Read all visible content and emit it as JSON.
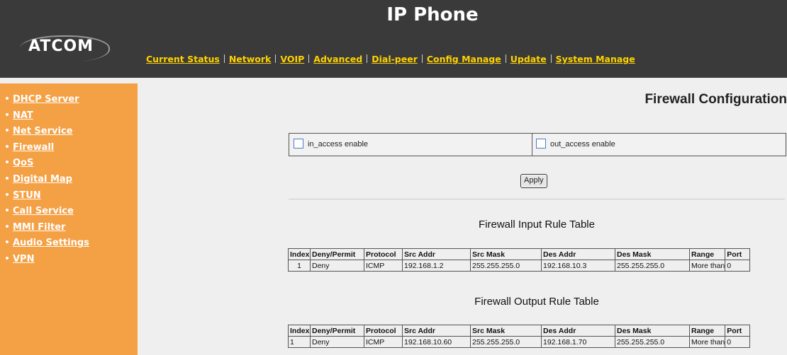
{
  "header": {
    "logo_text": "ATCOM",
    "title": "IP Phone",
    "nav": [
      "Current Status",
      "Network",
      "VOIP",
      "Advanced",
      "Dial-peer",
      "Config Manage",
      "Update",
      "System Manage"
    ]
  },
  "sidebar": {
    "items": [
      "DHCP Server",
      "NAT",
      "Net Service",
      "Firewall",
      "QoS",
      "Digital Map",
      "STUN",
      "Call Service",
      "MMI Filter",
      "Audio Settings",
      "VPN"
    ]
  },
  "main": {
    "page_title": "Firewall Configuration",
    "in_access_label": "in_access enable",
    "in_access_checked": false,
    "out_access_label": "out_access enable",
    "out_access_checked": false,
    "apply_label": "Apply",
    "input_table": {
      "title": "Firewall Input Rule Table",
      "headers": [
        "Index",
        "Deny/Permit",
        "Protocol",
        "Src Addr",
        "Src Mask",
        "Des Addr",
        "Des Mask",
        "Range",
        "Port"
      ],
      "rows": [
        [
          "1",
          "Deny",
          "ICMP",
          "192.168.1.2",
          "255.255.255.0",
          "192.168.10.3",
          "255.255.255.0",
          "More than",
          "0"
        ]
      ]
    },
    "output_table": {
      "title": "Firewall Output Rule Table",
      "headers": [
        "Index",
        "Deny/Permit",
        "Protocol",
        "Src Addr",
        "Src Mask",
        "Des Addr",
        "Des Mask",
        "Range",
        "Port"
      ],
      "rows": [
        [
          "1",
          "Deny",
          "ICMP",
          "192.168.10.60",
          "255.255.255.0",
          "192.168.1.70",
          "255.255.255.0",
          "More than",
          "0"
        ]
      ]
    }
  },
  "colors": {
    "header_bg": "#3a3a3a",
    "nav_link": "#ffd200",
    "sidebar_bg": "#f4a044",
    "content_bg": "#efefef"
  }
}
